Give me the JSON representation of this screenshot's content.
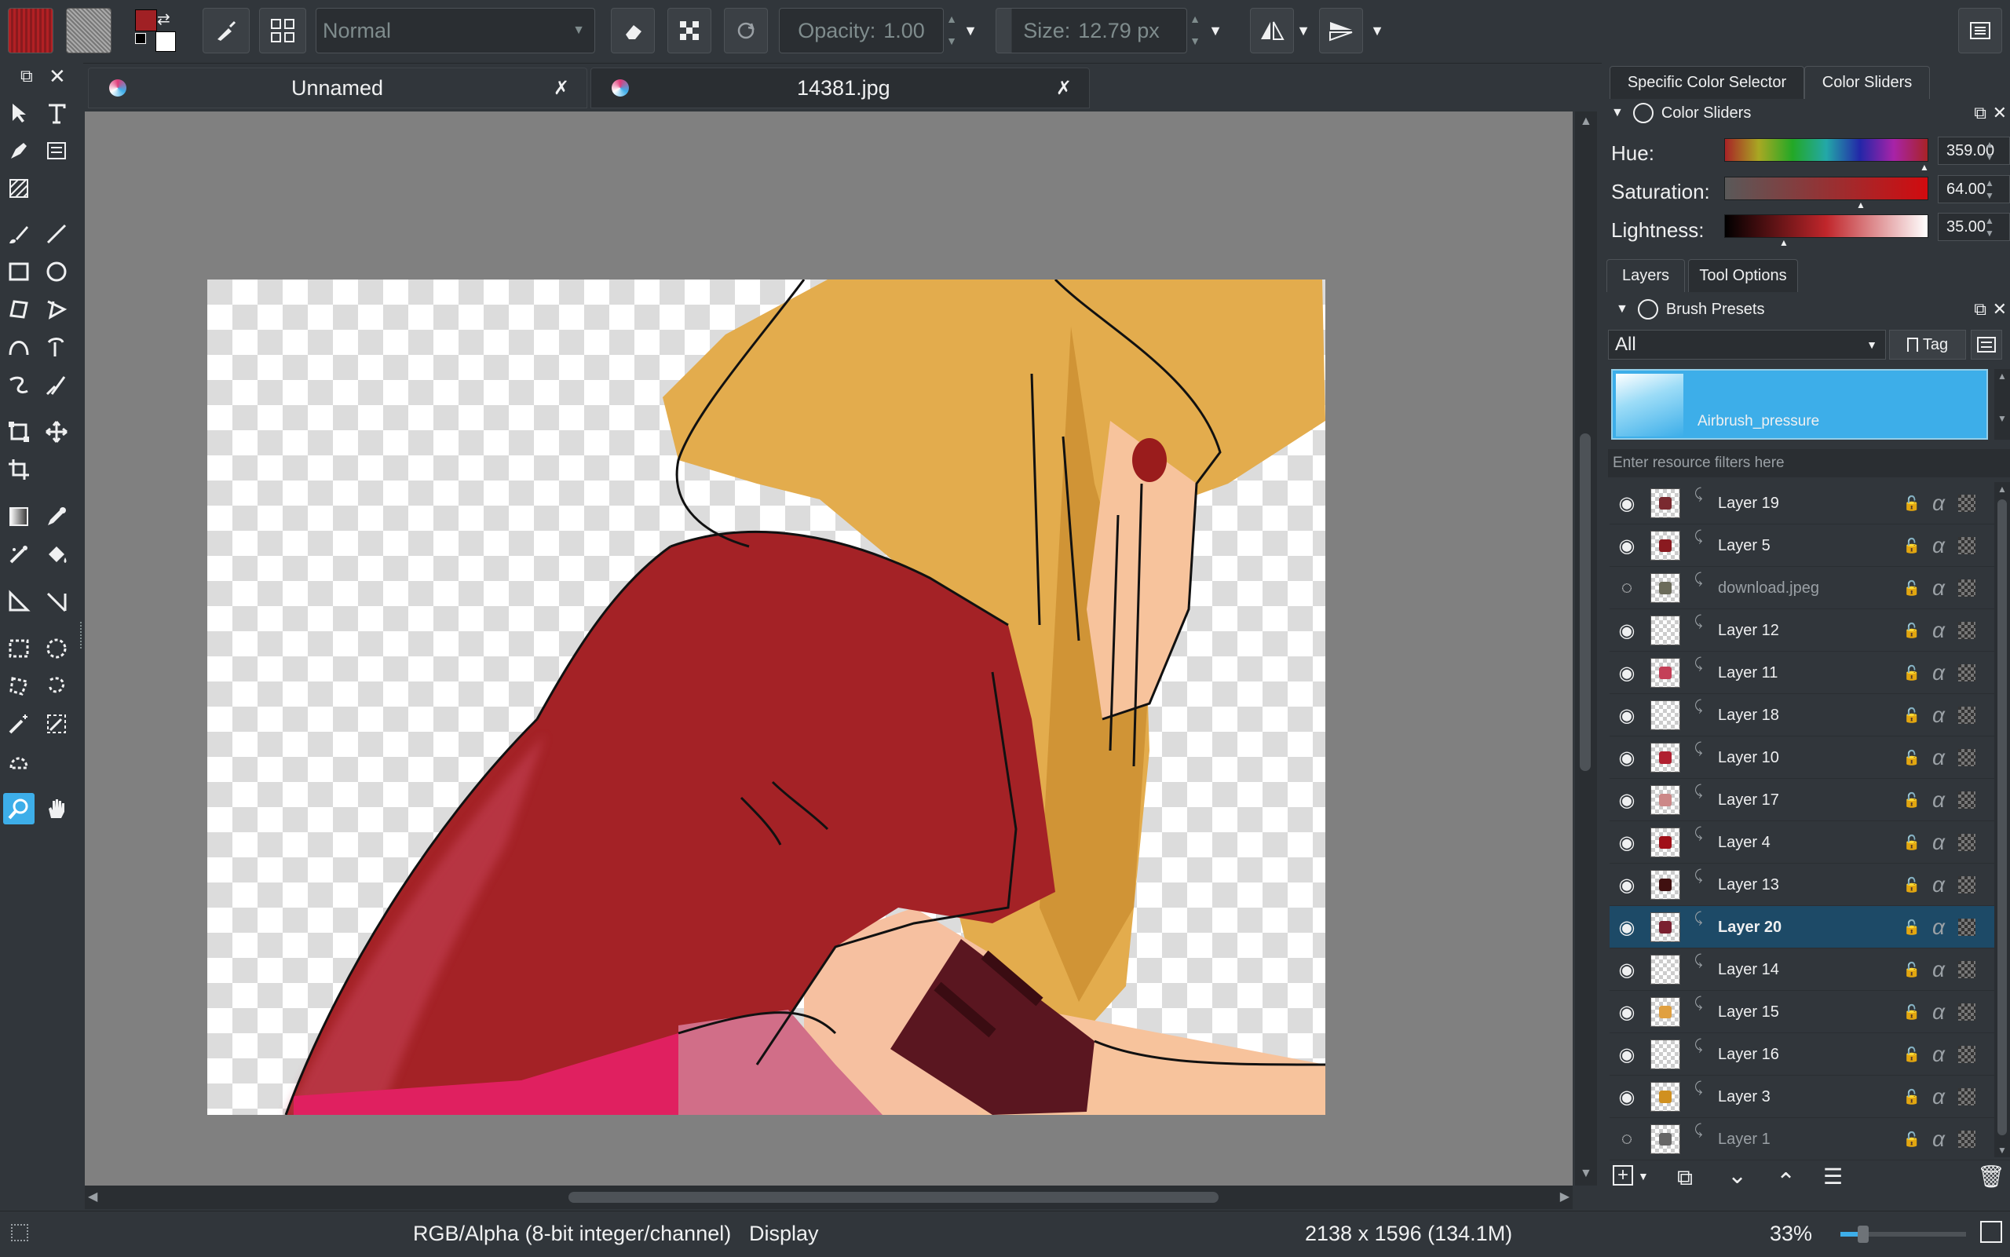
{
  "toolbar": {
    "blend_mode": "Normal",
    "opacity_label": "Opacity:",
    "opacity_value": "1.00",
    "size_label": "Size:",
    "size_value": "12.79 px",
    "fg_color": "#a02024",
    "bg_color": "#ffffff"
  },
  "tabs": [
    {
      "label": "Unnamed"
    },
    {
      "label": "14381.jpg"
    }
  ],
  "docker_tabs_top": [
    {
      "label": "Specific Color Selector"
    },
    {
      "label": "Color Sliders"
    }
  ],
  "color_sliders": {
    "title": "Color Sliders",
    "hue_label": "Hue:",
    "hue_value": "359.00",
    "sat_label": "Saturation:",
    "sat_value": "64.00",
    "light_label": "Lightness:",
    "light_value": "35.00"
  },
  "docker_tabs_mid": [
    {
      "label": "Layers"
    },
    {
      "label": "Tool Options"
    }
  ],
  "brush_presets": {
    "title": "Brush Presets",
    "filter_select": "All",
    "tag_label": "Tag",
    "selected_preset": "Airbrush_pressure",
    "filter_placeholder": "Enter resource filters here"
  },
  "layers": [
    {
      "name": "Layer 19",
      "visible": true,
      "selected": false
    },
    {
      "name": "Layer 5",
      "visible": true,
      "selected": false
    },
    {
      "name": "download.jpeg",
      "visible": false,
      "selected": false
    },
    {
      "name": "Layer 12",
      "visible": true,
      "selected": false
    },
    {
      "name": "Layer 11",
      "visible": true,
      "selected": false
    },
    {
      "name": "Layer 18",
      "visible": true,
      "selected": false
    },
    {
      "name": "Layer 10",
      "visible": true,
      "selected": false
    },
    {
      "name": "Layer 17",
      "visible": true,
      "selected": false
    },
    {
      "name": "Layer 4",
      "visible": true,
      "selected": false
    },
    {
      "name": "Layer 13",
      "visible": true,
      "selected": false
    },
    {
      "name": "Layer 20",
      "visible": true,
      "selected": true
    },
    {
      "name": "Layer 14",
      "visible": true,
      "selected": false
    },
    {
      "name": "Layer 15",
      "visible": true,
      "selected": false
    },
    {
      "name": "Layer 16",
      "visible": true,
      "selected": false
    },
    {
      "name": "Layer 3",
      "visible": true,
      "selected": false
    },
    {
      "name": "Layer 1",
      "visible": false,
      "selected": false
    }
  ],
  "status": {
    "color_space": "RGB/Alpha (8-bit integer/channel)",
    "display": "Display",
    "image_size": "2138 x 1596 (134.1M)",
    "zoom": "33%"
  }
}
